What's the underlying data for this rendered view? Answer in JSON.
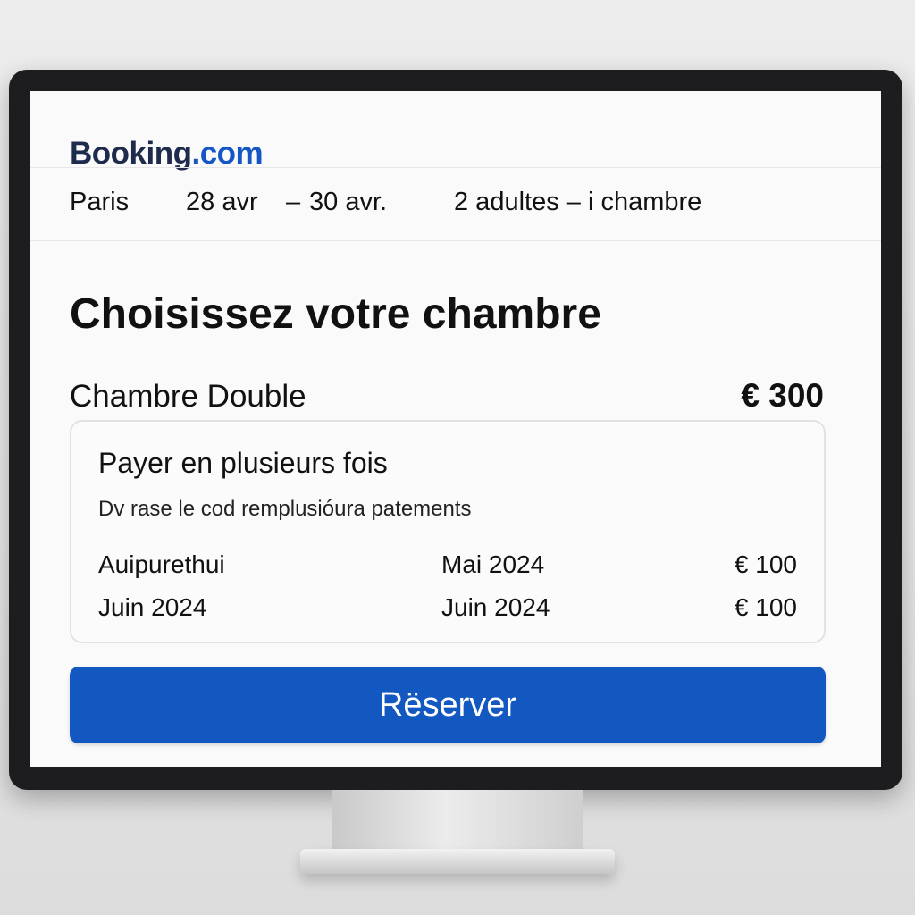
{
  "brand": {
    "name": "Booking",
    "domain": ".com"
  },
  "search": {
    "destination": "Paris",
    "check_in": "28 avr",
    "date_separator": "–",
    "check_out": "30 avr.",
    "guests": "2 adultes – i chambre"
  },
  "page": {
    "title": "Choisissez votre chambre"
  },
  "room": {
    "name": "Chambre Double",
    "price": "€ 300"
  },
  "installments": {
    "title": "Payer en plusieurs fois",
    "subtitle": "Dv rase le cod remplusióura patements",
    "rows": [
      {
        "label": "Auipurethui",
        "date": "Mai 2024",
        "amount": "€ 100"
      },
      {
        "label": "Juin 2024",
        "date": "Juin 2024",
        "amount": "€ 100"
      }
    ]
  },
  "actions": {
    "reserve_label": "Rëserver"
  },
  "colors": {
    "brand_dark": "#1f2b4d",
    "brand_blue": "#1456c5",
    "button_bg": "#1357c0"
  }
}
